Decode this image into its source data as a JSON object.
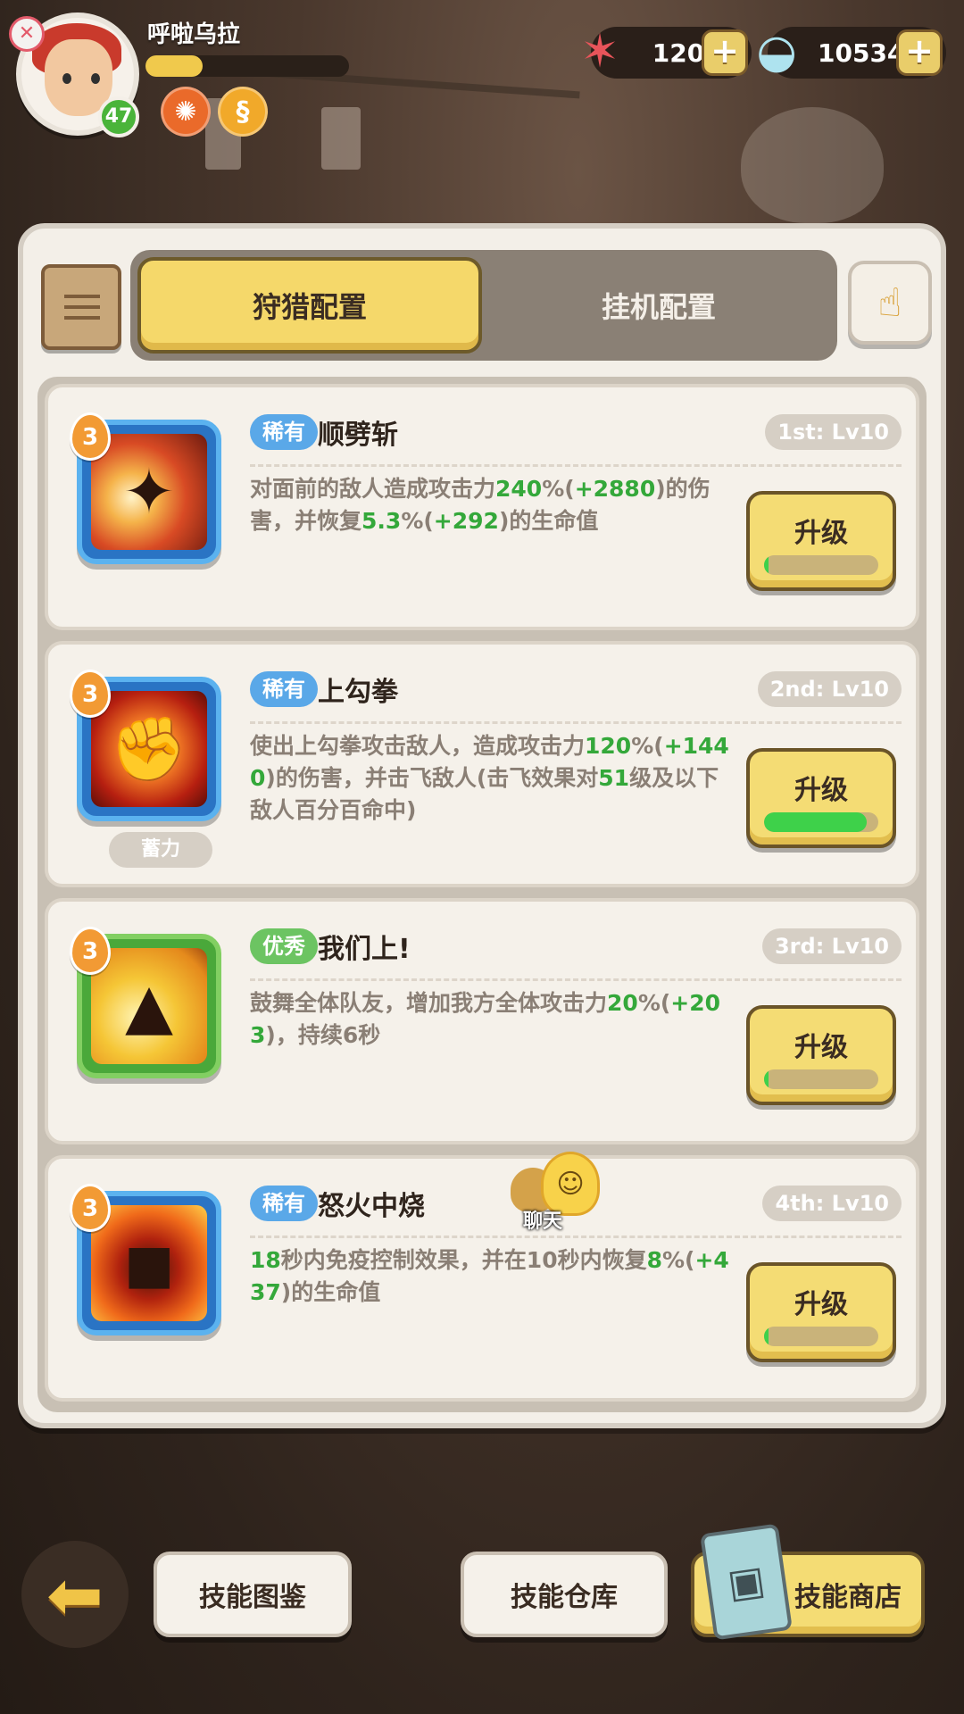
{
  "player": {
    "name": "呼啦乌拉",
    "level": "47",
    "xp_progress": 0.28,
    "avatar_badge": "✕"
  },
  "status_icons": [
    {
      "name": "orange-gear-icon",
      "glyph": "✺"
    },
    {
      "name": "gold-swirl-icon",
      "glyph": "§"
    }
  ],
  "currencies": [
    {
      "name": "starfish",
      "icon": "starfish-icon",
      "glyph": "✶",
      "amount": "120"
    },
    {
      "name": "shell",
      "icon": "shell-icon",
      "glyph": "◒",
      "amount": "105342"
    }
  ],
  "tabs": {
    "hunt": "狩猎配置",
    "idle": "挂机配置"
  },
  "skills": [
    {
      "stack": "3",
      "rarity": "稀有",
      "rarity_type": "rare",
      "name": "顺劈斩",
      "slot": "1st: Lv10",
      "desc_parts": [
        {
          "t": "对面前的敌人造成攻击力",
          "g": false
        },
        {
          "t": "240",
          "g": true
        },
        {
          "t": "%(",
          "g": false
        },
        {
          "t": "+2880",
          "g": true
        },
        {
          "t": ")的伤害，并恢复",
          "g": false
        },
        {
          "t": "5.3",
          "g": true
        },
        {
          "t": "%(",
          "g": false
        },
        {
          "t": "+292",
          "g": true
        },
        {
          "t": ")的生命值",
          "g": false
        }
      ],
      "upgrade_label": "升级",
      "progress": 0.04,
      "charge_tag": ""
    },
    {
      "stack": "3",
      "rarity": "稀有",
      "rarity_type": "rare",
      "name": "上勾拳",
      "slot": "2nd: Lv10",
      "desc_parts": [
        {
          "t": "使出上勾拳攻击敌人，造成攻击力",
          "g": false
        },
        {
          "t": "120",
          "g": true
        },
        {
          "t": "%(",
          "g": false
        },
        {
          "t": "+1440",
          "g": true
        },
        {
          "t": ")的伤害，并击飞敌人(击飞效果对",
          "g": false
        },
        {
          "t": "51",
          "g": true
        },
        {
          "t": "级及以下敌人百分百命中)",
          "g": false
        }
      ],
      "upgrade_label": "升级",
      "progress": 0.9,
      "charge_tag": "蓄力"
    },
    {
      "stack": "3",
      "rarity": "优秀",
      "rarity_type": "good",
      "name": "我们上!",
      "slot": "3rd: Lv10",
      "desc_parts": [
        {
          "t": "鼓舞全体队友，增加我方全体攻击力",
          "g": false
        },
        {
          "t": "20",
          "g": true
        },
        {
          "t": "%(",
          "g": false
        },
        {
          "t": "+203",
          "g": true
        },
        {
          "t": ")，持续6秒",
          "g": false
        }
      ],
      "upgrade_label": "升级",
      "progress": 0.04,
      "charge_tag": ""
    },
    {
      "stack": "3",
      "rarity": "稀有",
      "rarity_type": "rare",
      "name": "怒火中烧",
      "slot": "4th: Lv10",
      "desc_parts": [
        {
          "t": "18",
          "g": true
        },
        {
          "t": "秒内免疫控制效果，并在10秒内恢复",
          "g": false
        },
        {
          "t": "8",
          "g": true
        },
        {
          "t": "%(",
          "g": false
        },
        {
          "t": "+437",
          "g": true
        },
        {
          "t": ")的生命值",
          "g": false
        }
      ],
      "upgrade_label": "升级",
      "progress": 0.04,
      "charge_tag": ""
    }
  ],
  "chat": {
    "label": "聊天"
  },
  "bottom": {
    "codex": "技能图鉴",
    "storage": "技能仓库",
    "shop": "技能商店"
  },
  "colors": {
    "accent_yellow": "#f4dc74",
    "rare_blue": "#5aa8e8",
    "good_green": "#6cc462",
    "value_green": "#34a83a"
  }
}
